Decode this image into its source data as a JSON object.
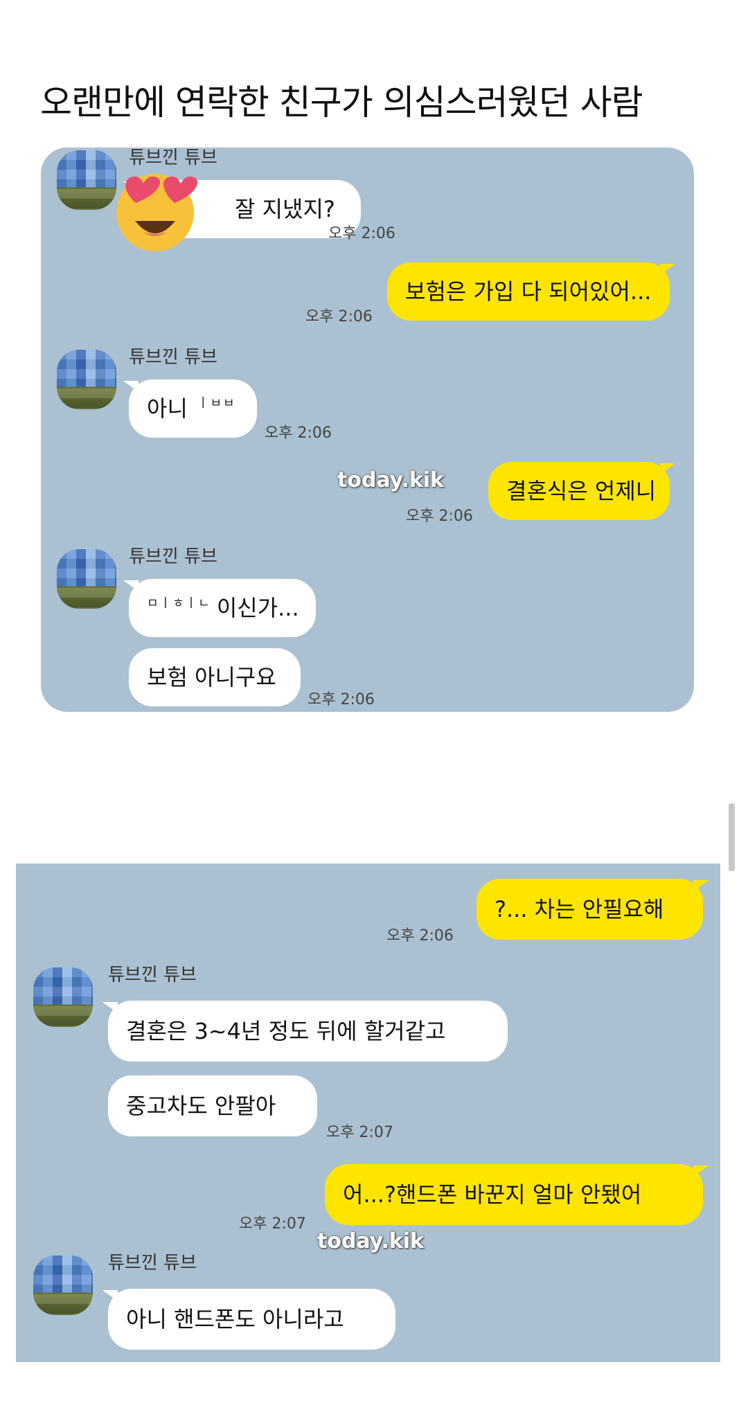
{
  "post_title": "오랜만에 연락한 친구가 의심스러웠던 사람",
  "watermark": "today.kik",
  "sender_name": "튜브낀 튜브",
  "chat1": {
    "messages": [
      {
        "text": "잘 지냈지?",
        "time": "오후 2:06"
      },
      {
        "text": "보험은 가입 다 되어있어...",
        "time": "오후 2:06"
      },
      {
        "text": "아니",
        "redacted": "ㅣㅂㅂ",
        "time": "오후 2:06"
      },
      {
        "text": "결혼식은 언제니",
        "time": "오후 2:06"
      },
      {
        "text": "이신가...",
        "redacted": "ㅁㅣㅎㅣㄴ",
        "time": ""
      },
      {
        "text": "보험 아니구요",
        "time": "오후 2:06"
      }
    ]
  },
  "chat2": {
    "messages": [
      {
        "text": "?... 차는 안필요해",
        "time": "오후 2:06"
      },
      {
        "text": "결혼은 3~4년 정도 뒤에 할거같고",
        "time": ""
      },
      {
        "text": "중고차도 안팔아",
        "time": "오후 2:07"
      },
      {
        "text": "어...?핸드폰 바꾼지 얼마 안됐어",
        "time": "오후 2:07"
      },
      {
        "text": "아니 핸드폰도 아니라고",
        "time": ""
      }
    ]
  },
  "colors": {
    "chat_background": "#abc1d1",
    "my_bubble": "#fee500",
    "friend_bubble": "#ffffff"
  },
  "icons": {
    "sticker": "heart-eyes-emoji-icon"
  }
}
